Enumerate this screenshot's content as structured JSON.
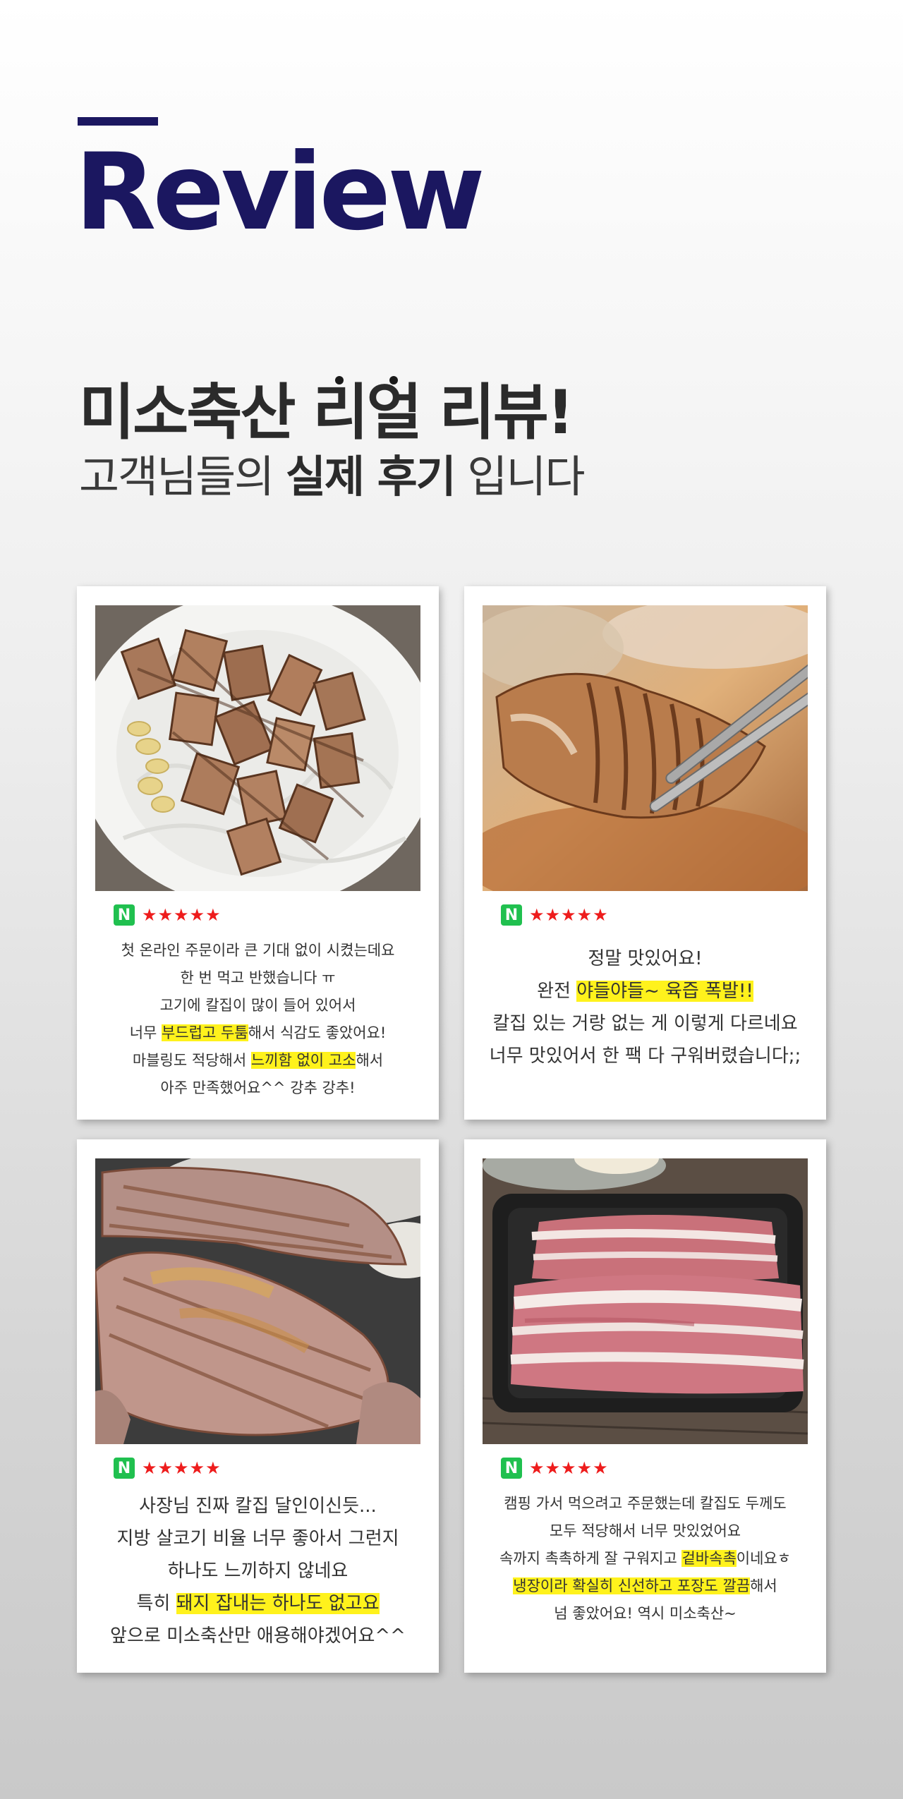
{
  "header": {
    "title": "Review",
    "headline": {
      "part1": "미소축산 ",
      "dot1": "리",
      "dot2": "얼",
      "part2": " 리뷰!"
    },
    "subhead": {
      "pre": "고객님들의 ",
      "bold": "실제 후기",
      "post": " 입니다"
    }
  },
  "colors": {
    "brand": "#1b1760",
    "highlight": "#fff21c",
    "naver": "#20c04f",
    "stars": "#ee1c1c"
  },
  "reviews": [
    {
      "icon": "naver-n-icon",
      "platform_glyph": "N",
      "stars": "★★★★★",
      "photo": "grilled-pork-belly-plate",
      "lines": [
        {
          "a": "첫 온라인 주문이라 큰 기대 없이 시켰는데요"
        },
        {
          "a": "한 번 먹고 반했습니다 ㅠ"
        },
        {
          "a": "고기에 칼집이 많이 들어 있어서"
        },
        {
          "a": "너무 ",
          "h": "부드럽고 두툼",
          "b": "해서 식감도 좋았어요!"
        },
        {
          "a": "마블링도 적당해서 ",
          "h": "느끼함 없이 고소",
          "b": "해서"
        },
        {
          "a": "아주 만족했어요^^ 강추 강추!"
        }
      ]
    },
    {
      "icon": "naver-n-icon",
      "platform_glyph": "N",
      "stars": "★★★★★",
      "photo": "pork-piece-with-chopsticks",
      "lines": [
        {
          "a": "정말 맛있어요!"
        },
        {
          "a": "완전 ",
          "h": "야들야들~ 육즙 폭발!!"
        },
        {
          "a": "칼집 있는 거랑 없는 게 이렇게 다르네요"
        },
        {
          "a": "너무 맛있어서 한 팩 다 구워버렸습니다;;"
        }
      ]
    },
    {
      "icon": "naver-n-icon",
      "platform_glyph": "N",
      "stars": "★★★★★",
      "photo": "pork-grilling-on-pan",
      "lines": [
        {
          "a": "사장님 진짜 칼집 달인이신듯..."
        },
        {
          "a": "지방 살코기 비율 너무 좋아서 그런지"
        },
        {
          "a": "하나도 느끼하지 않네요"
        },
        {
          "a": "특히 ",
          "h": "돼지 잡내는 하나도 없고요"
        },
        {
          "a": "앞으로 미소축산만 애용해야겠어요^^"
        }
      ]
    },
    {
      "icon": "naver-n-icon",
      "platform_glyph": "N",
      "stars": "★★★★★",
      "photo": "raw-pork-belly-in-tray",
      "lines": [
        {
          "a": "캠핑 가서 먹으려고 주문했는데 칼집도 두께도"
        },
        {
          "a": "모두 적당해서 너무 맛있었어요"
        },
        {
          "a": "속까지 촉촉하게 잘 구워지고 ",
          "h": "겉바속촉",
          "b": "이네요ㅎ"
        },
        {
          "h": "냉장이라 확실히 신선하고 포장도 깔끔",
          "b": "해서"
        },
        {
          "a": "넘 좋았어요! 역시 미소축산~"
        }
      ]
    }
  ]
}
